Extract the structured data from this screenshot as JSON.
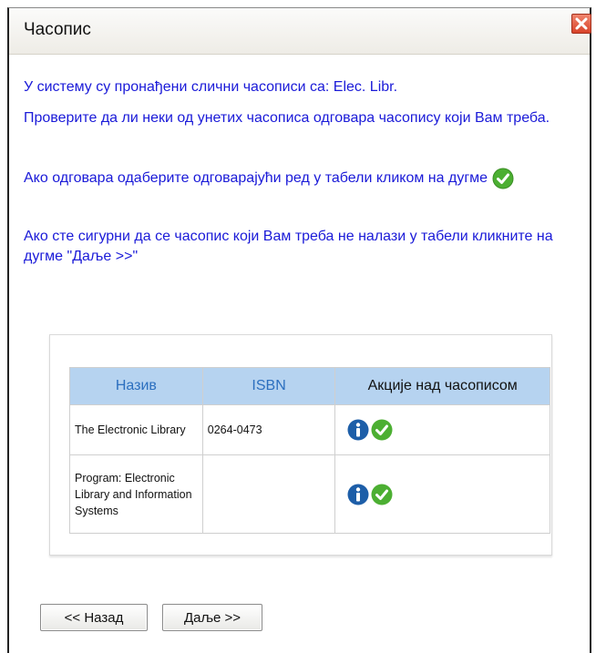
{
  "dialog": {
    "title": "Часопис",
    "close_icon": "close-icon"
  },
  "messages": {
    "line1": "У систему су пронађени слични часописи са: Elec. Libr.",
    "line2": "Проверите да ли неки од унетих часописа одговара часопису који Вам треба.",
    "line3": "Ако одговара одаберите одговарајући ред у табели кликом на дугме",
    "line4": "Ако сте сигурни да се часопис који Вам треба не налази у табели кликните на дугме \"Даље >>\""
  },
  "table": {
    "headers": [
      "Назив",
      "ISBN",
      "Акције над часописом"
    ],
    "rows": [
      {
        "name": "The Electronic Library",
        "isbn": "0264-0473",
        "actions": [
          "info-icon",
          "check-icon"
        ]
      },
      {
        "name": "Program: Electronic Library and Information Systems",
        "isbn": "",
        "actions": [
          "info-icon",
          "check-icon"
        ]
      }
    ]
  },
  "buttons": {
    "back": "<< Назад",
    "next": "Даље >>"
  },
  "colors": {
    "message_text": "#1a1ad8",
    "header_bg": "#b6d3f0",
    "check_green": "#4caf32",
    "info_blue": "#1d5ea8",
    "close_red": "#d8432a"
  }
}
